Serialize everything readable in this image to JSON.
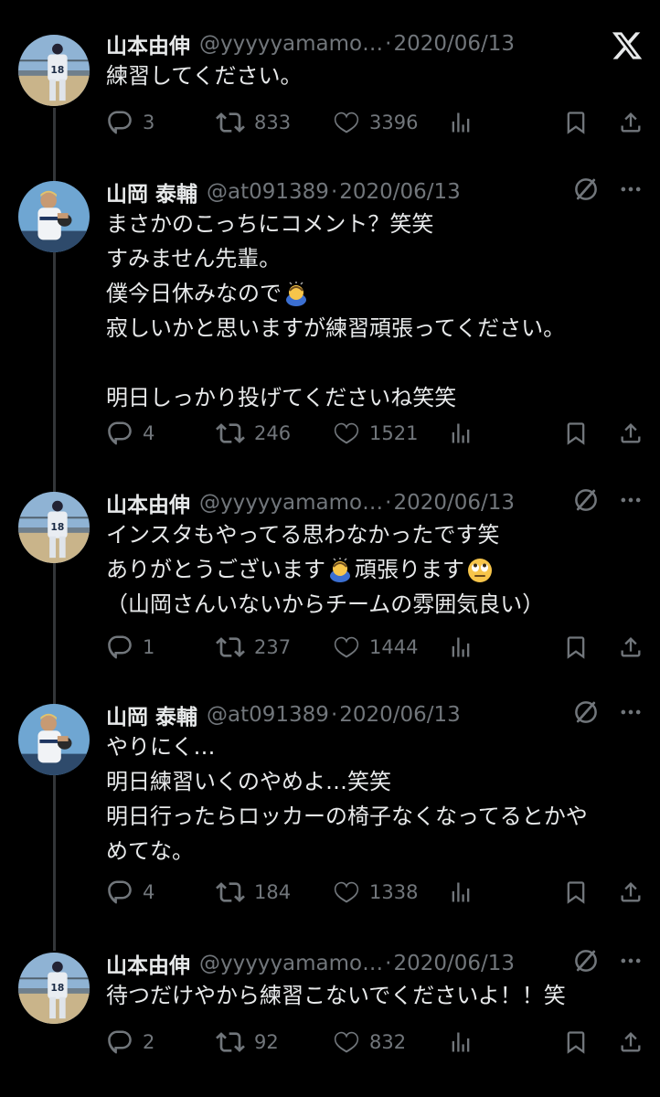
{
  "tweets": [
    {
      "name": "山本由伸",
      "handle": "@yyyyyamamo…",
      "date": "2020/06/13",
      "lines": [
        "練習してください。"
      ],
      "replies": "3",
      "retweets": "833",
      "likes": "3396"
    },
    {
      "name": "山岡 泰輔",
      "handle": "@at091389",
      "date": "2020/06/13",
      "lines": [
        "まさかのこっちにコメント？笑笑",
        "すみません先輩。",
        "僕今日休みなので",
        "寂しいかと思いますが練習頑張ってください。",
        "",
        "明日しっかり投げてくださいね笑笑"
      ],
      "replies": "4",
      "retweets": "246",
      "likes": "1521"
    },
    {
      "name": "山本由伸",
      "handle": "@yyyyyamamo…",
      "date": "2020/06/13",
      "lines": [
        "インスタもやってる思わなかったです笑",
        "ありがとうございます",
        "（山岡さんいないからチームの雰囲気良い）"
      ],
      "line2_suffix": "頑張ります",
      "replies": "1",
      "retweets": "237",
      "likes": "1444"
    },
    {
      "name": "山岡 泰輔",
      "handle": "@at091389",
      "date": "2020/06/13",
      "lines": [
        "やりにく…",
        "明日練習いくのやめよ…笑笑",
        "明日行ったらロッカーの椅子なくなってるとかや",
        "めてな。"
      ],
      "replies": "4",
      "retweets": "184",
      "likes": "1338"
    },
    {
      "name": "山本由伸",
      "handle": "@yyyyyamamo…",
      "date": "2020/06/13",
      "lines": [
        "待つだけやから練習こないでくださいよ！！笑"
      ],
      "replies": "2",
      "retweets": "92",
      "likes": "832"
    }
  ],
  "dot": "·",
  "colors": {
    "background": "#000000",
    "text": "#e7e9ea",
    "muted": "#71767b",
    "thread_line": "#333639"
  },
  "icons": [
    "x-logo-icon",
    "grok-icon",
    "more-icon",
    "reply-icon",
    "retweet-icon",
    "like-icon",
    "views-icon",
    "bookmark-icon",
    "share-icon",
    "bowing-emoji",
    "eye-roll-emoji"
  ]
}
